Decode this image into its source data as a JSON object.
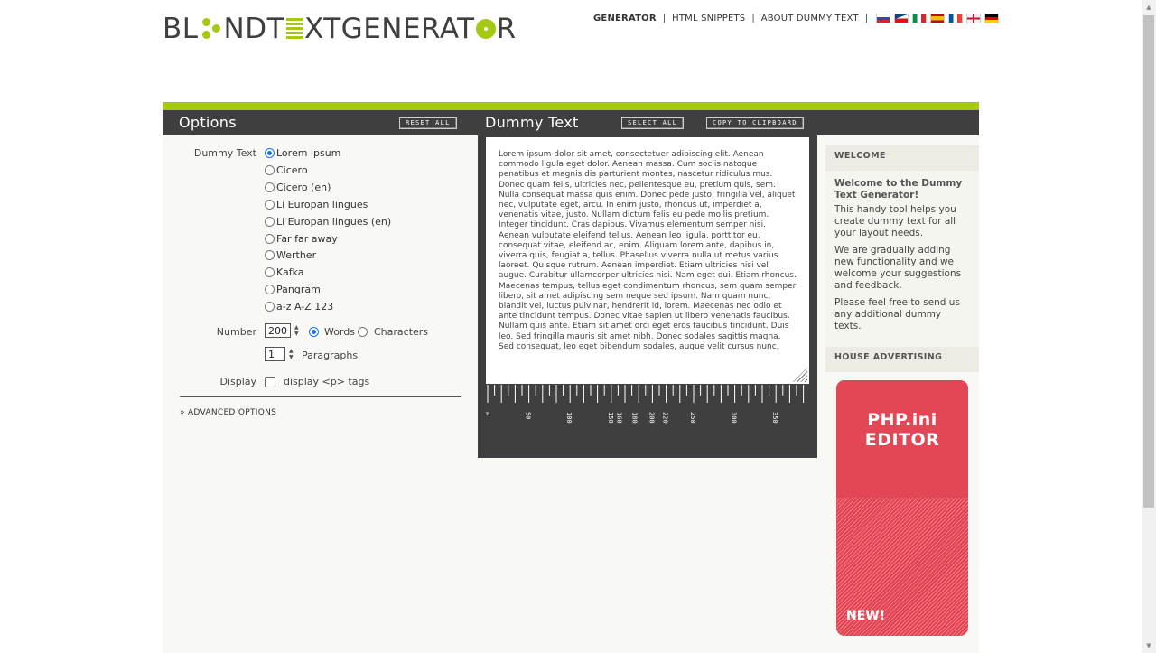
{
  "logo": {
    "part1": "BL",
    "part2": "NDT",
    "part3": "XTGENERAT",
    "part4": "R"
  },
  "nav": {
    "generator": "GENERATOR",
    "html_snippets": "HTML SNIPPETS",
    "about": "ABOUT DUMMY TEXT"
  },
  "flags": [
    "ru",
    "cz",
    "it",
    "es",
    "fr",
    "en",
    "de"
  ],
  "options": {
    "title": "Options",
    "reset_all": "RESET ALL",
    "dummy_text_label": "Dummy Text",
    "texts": [
      "Lorem ipsum",
      "Cicero",
      "Cicero (en)",
      "Li Europan lingues",
      "Li Europan lingues (en)",
      "Far far away",
      "Werther",
      "Kafka",
      "Pangram",
      "a-z A-Z 123"
    ],
    "selected_text": "Lorem ipsum",
    "number_label": "Number",
    "number_value": "200",
    "words_label": "Words",
    "characters_label": "Characters",
    "paragraphs_value": "1",
    "paragraphs_label": "Paragraphs",
    "display_label": "Display",
    "display_tags_label": "display <p> tags",
    "advanced_label": "» ADVANCED OPTIONS"
  },
  "dummy": {
    "title": "Dummy Text",
    "select_all": "SELECT ALL",
    "copy": "COPY TO CLIPBOARD",
    "text": "Lorem ipsum dolor sit amet, consectetuer adipiscing elit. Aenean commodo ligula eget dolor. Aenean massa. Cum sociis natoque penatibus et magnis dis parturient montes, nascetur ridiculus mus. Donec quam felis, ultricies nec, pellentesque eu, pretium quis, sem. Nulla consequat massa quis enim. Donec pede justo, fringilla vel, aliquet nec, vulputate eget, arcu. In enim justo, rhoncus ut, imperdiet a, venenatis vitae, justo. Nullam dictum felis eu pede mollis pretium. Integer tincidunt. Cras dapibus. Vivamus elementum semper nisi. Aenean vulputate eleifend tellus. Aenean leo ligula, porttitor eu, consequat vitae, eleifend ac, enim. Aliquam lorem ante, dapibus in, viverra quis, feugiat a, tellus. Phasellus viverra nulla ut metus varius laoreet. Quisque rutrum. Aenean imperdiet. Etiam ultricies nisi vel augue. Curabitur ullamcorper ultricies nisi. Nam eget dui. Etiam rhoncus. Maecenas tempus, tellus eget condimentum rhoncus, sem quam semper libero, sit amet adipiscing sem neque sed ipsum. Nam quam nunc, blandit vel, luctus pulvinar, hendrerit id, lorem. Maecenas nec odio et ante tincidunt tempus. Donec vitae sapien ut libero venenatis faucibus. Nullam quis ante. Etiam sit amet orci eget eros faucibus tincidunt. Duis leo. Sed fringilla mauris sit amet nibh. Donec sodales sagittis magna. Sed consequat, leo eget bibendum sodales, augue velit cursus nunc,",
    "ruler_labels": [
      "0",
      "50",
      "100",
      "150",
      "160",
      "180",
      "200",
      "220",
      "250",
      "300",
      "350"
    ]
  },
  "sidebar": {
    "welcome_head": "WELCOME",
    "welcome_lead": "Welcome to the Dummy Text Generator!",
    "p1": "This handy tool helps you create dummy text for all your layout needs.",
    "p2": "We are gradually adding new functionality and we welcome your suggestions and feedback.",
    "p3": "Please feel free to send us any additional dummy texts.",
    "ad_head": "HOUSE ADVERTISING",
    "ad_line1": "PHP.ini",
    "ad_line2": "EDITOR",
    "ad_badge": "NEW!"
  },
  "colors": {
    "accent": "#a5c813",
    "dark": "#3f3f3f",
    "ad": "#e34756"
  }
}
